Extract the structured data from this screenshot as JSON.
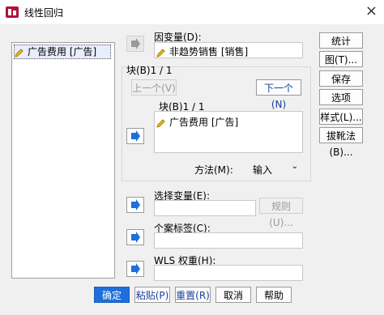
{
  "window": {
    "title": "线性回归"
  },
  "variables_list": {
    "items": [
      "广告费用 [广告]"
    ]
  },
  "dependent": {
    "label": "因变量(D):",
    "value": "非趋势销售 [销售]"
  },
  "block": {
    "frame_label": "块(B)1 / 1",
    "prev_label": "上一个(V)",
    "next_label": "下一个(N)",
    "inner_label": "块(B)1 / 1",
    "independents": [
      "广告费用 [广告]"
    ],
    "method_label": "方法(M):",
    "method_value": "输入"
  },
  "selection": {
    "label": "选择变量(E):",
    "rule_label": "规则(U)..."
  },
  "case_labels": {
    "label": "个案标签(C):"
  },
  "wls": {
    "label": "WLS 权重(H):"
  },
  "side_buttons": [
    "统计(S)...",
    "图(T)...",
    "保存(S)...",
    "选项(O)...",
    "样式(L)...",
    "拔靴法(B)..."
  ],
  "footer": {
    "ok": "确定",
    "paste": "粘贴(P)",
    "reset": "重置(R)",
    "cancel": "取消",
    "help": "帮助"
  },
  "colors": {
    "primary": "#1e6fd9",
    "arrow": "#1e6fd9"
  }
}
